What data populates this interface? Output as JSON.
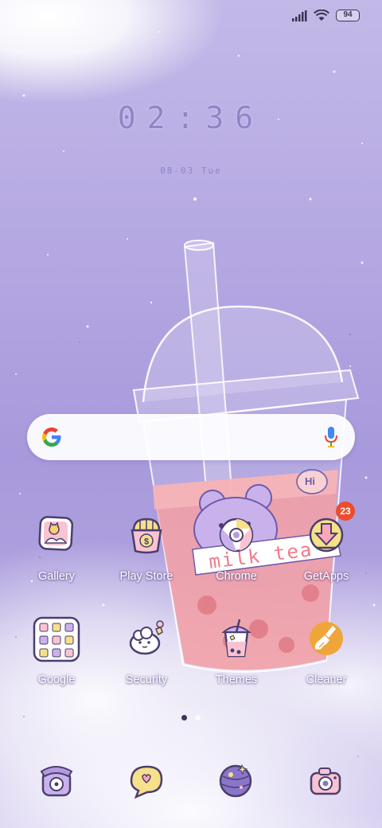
{
  "status_bar": {
    "battery_level": "94",
    "icons": [
      "signal-icon",
      "wifi-icon",
      "battery-icon"
    ]
  },
  "clock": {
    "time": "02:36",
    "date": "08-03 Tue"
  },
  "wallpaper": {
    "cup_text": "milk tea",
    "bubble_text": "Hi"
  },
  "search": {
    "logo": "google-g-icon",
    "mic": "mic-icon"
  },
  "apps": [
    {
      "label": "Gallery",
      "icon": "gallery-icon"
    },
    {
      "label": "Play Store",
      "icon": "play-store-icon"
    },
    {
      "label": "Chrome",
      "icon": "chrome-icon"
    },
    {
      "label": "GetApps",
      "icon": "getapps-icon",
      "badge": "23"
    },
    {
      "label": "Google",
      "icon": "google-folder-icon"
    },
    {
      "label": "Security",
      "icon": "security-icon"
    },
    {
      "label": "Themes",
      "icon": "themes-icon"
    },
    {
      "label": "Cleaner",
      "icon": "cleaner-icon"
    }
  ],
  "pager": {
    "pages": 2,
    "active": 1
  },
  "dock": [
    {
      "icon": "phone-icon"
    },
    {
      "icon": "messages-icon"
    },
    {
      "icon": "browser-icon"
    },
    {
      "icon": "camera-icon"
    }
  ],
  "colors": {
    "background": "#b5a8e2",
    "clock_text": "#8f85c8",
    "badge": "#ef4c2b",
    "icon_yellow": "#f7e08a",
    "icon_outline": "#4a3f6e"
  }
}
